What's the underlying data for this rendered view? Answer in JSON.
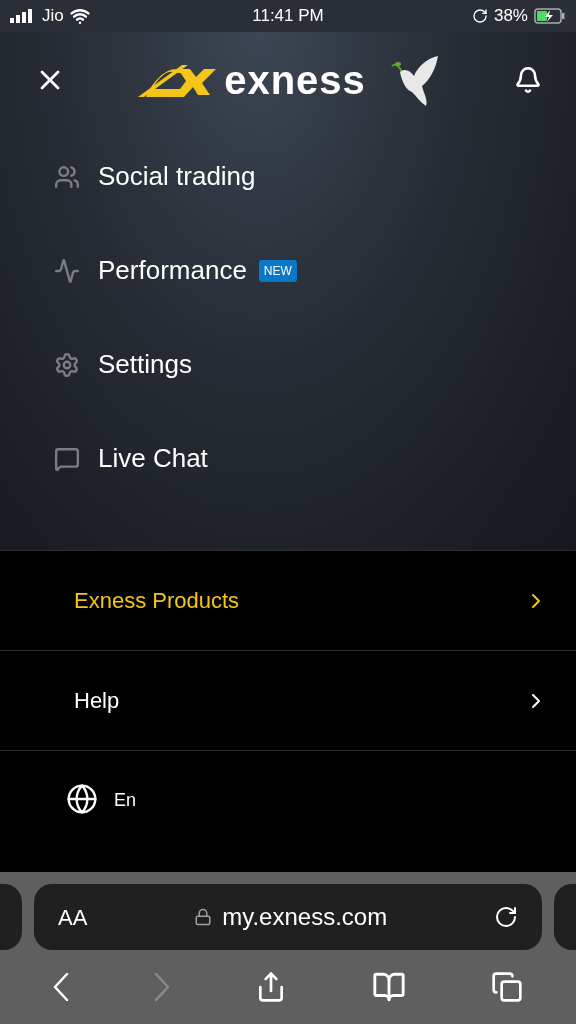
{
  "status_bar": {
    "carrier": "Jio",
    "time": "11:41 PM",
    "battery": "38%"
  },
  "header": {
    "logo_text": "exness"
  },
  "menu": [
    {
      "label": "Social trading"
    },
    {
      "label": "Performance",
      "badge": "NEW"
    },
    {
      "label": "Settings"
    },
    {
      "label": "Live Chat"
    }
  ],
  "sections": [
    {
      "label": "Exness Products",
      "selected": true
    },
    {
      "label": "Help",
      "selected": false
    }
  ],
  "language": "En",
  "browser": {
    "text_size": "AA",
    "url": "my.exness.com",
    "forward_disabled": true
  }
}
